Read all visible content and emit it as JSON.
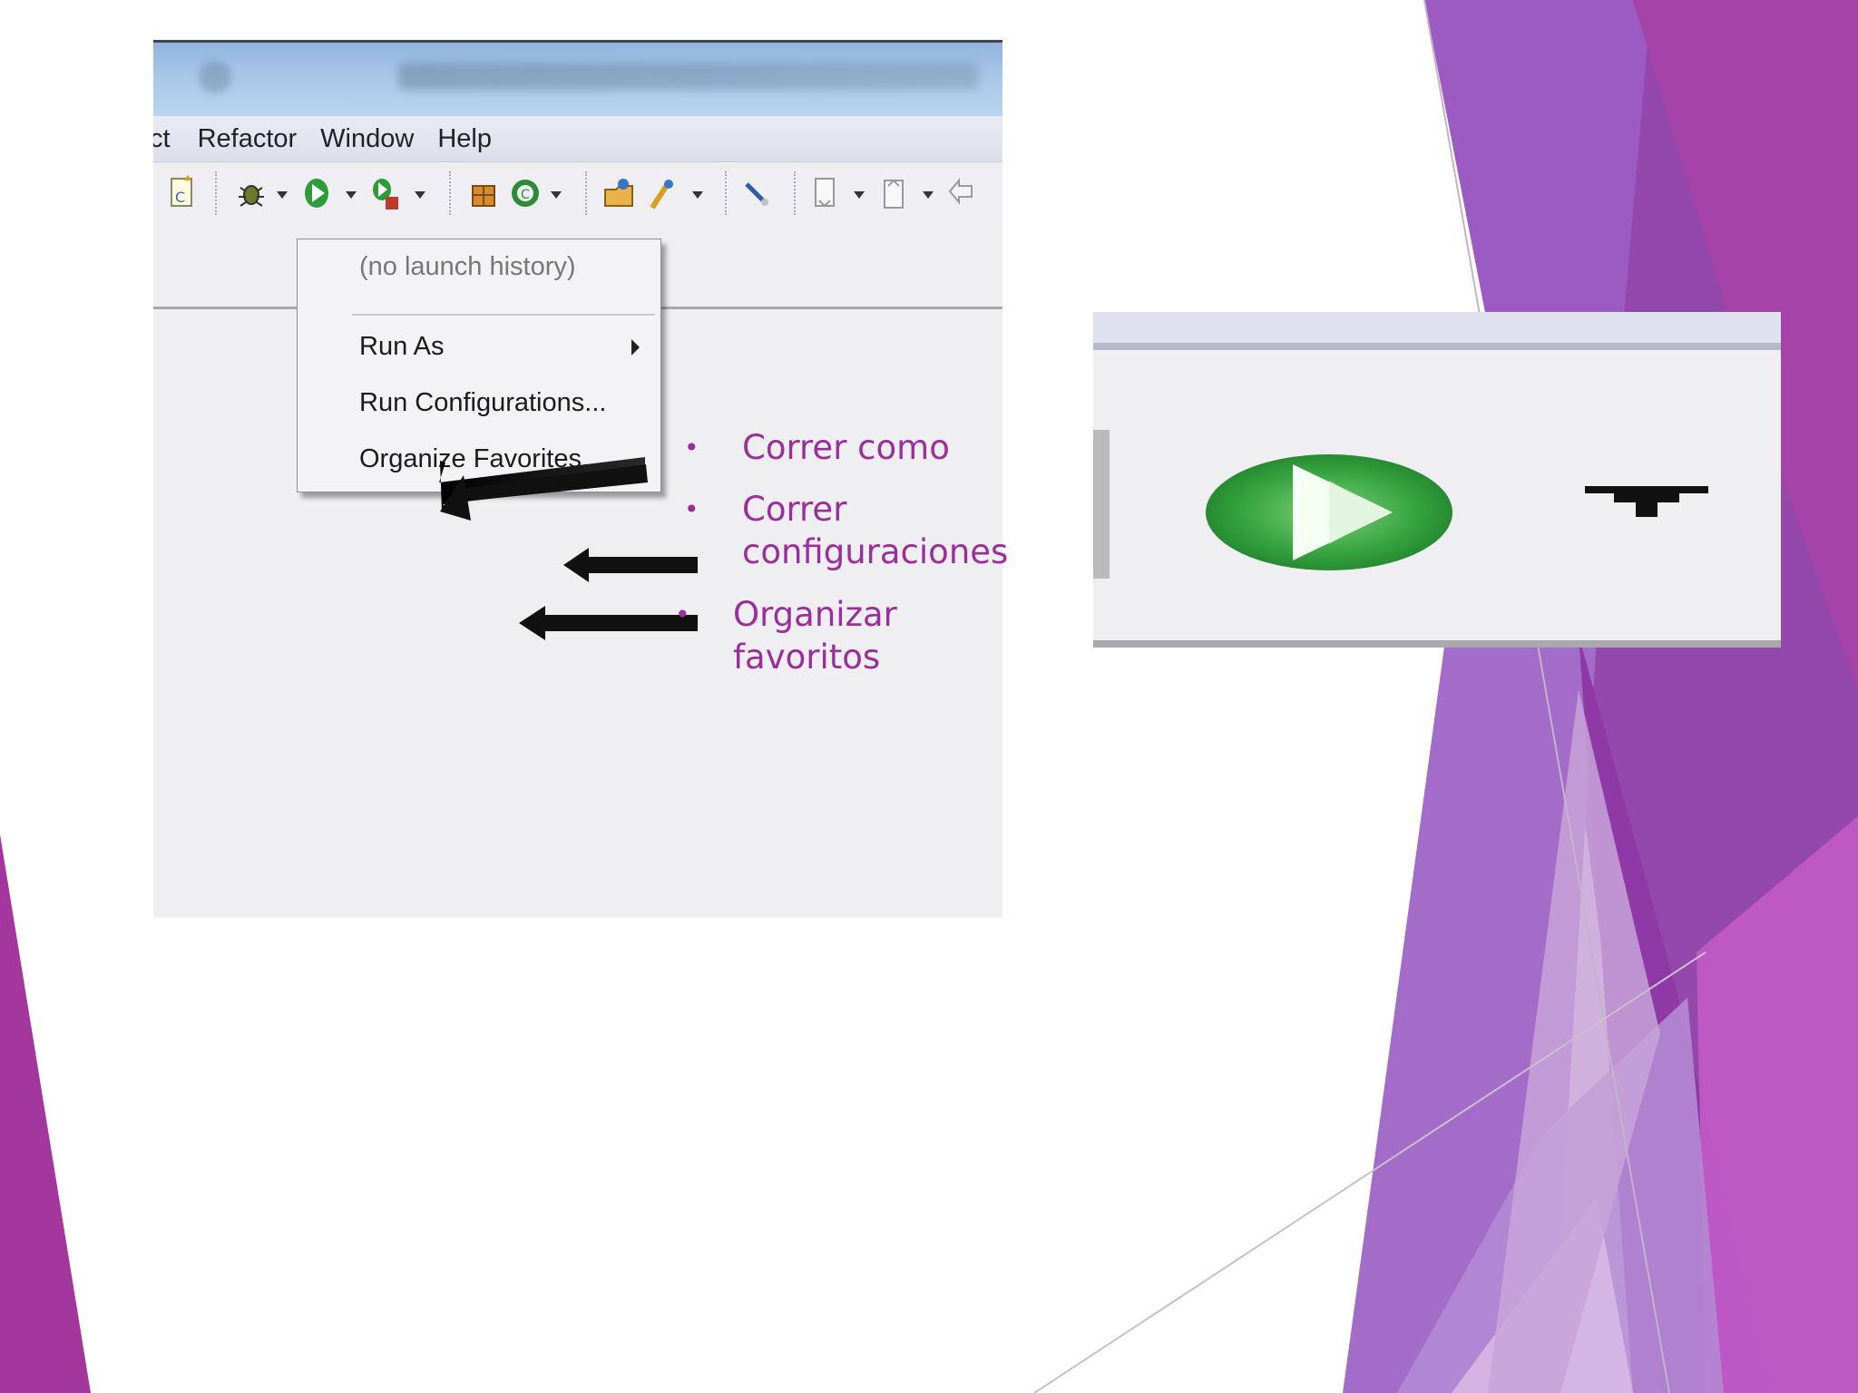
{
  "menu_bar": {
    "items": [
      "ct",
      "Refactor",
      "Window",
      "Help"
    ]
  },
  "run_menu": {
    "history": "(no launch history)",
    "items": [
      "Run As",
      "Run Configurations...",
      "Organize Favorites..."
    ]
  },
  "bullets": [
    {
      "dot": "•",
      "text": [
        "Correr como"
      ]
    },
    {
      "dot": "•",
      "text": [
        "Correr",
        "configuraciones"
      ]
    },
    {
      "dot": "•",
      "text": [
        "Organizar",
        "favoritos"
      ]
    }
  ],
  "colors": {
    "accent_purple": "#9a2f9c",
    "run_green": "#2e9b3a"
  },
  "icons": [
    "debug-icon",
    "run-icon",
    "external-tools-icon",
    "dropdown-arrow-icon"
  ]
}
